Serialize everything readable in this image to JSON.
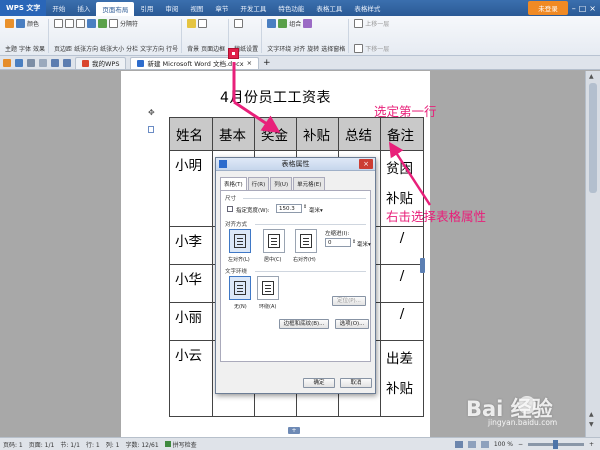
{
  "menubar": {
    "app_name": "WPS 文字",
    "tabs": [
      "开始",
      "插入",
      "页面布局",
      "引用",
      "审阅",
      "视图",
      "章节",
      "开发工具",
      "特色功能",
      "表格工具",
      "表格样式"
    ],
    "active_tab": "页面布局",
    "login_label": "未登录"
  },
  "ribbon": {
    "theme": "主题",
    "color": "颜色",
    "font": "字体",
    "effect": "效果",
    "margin": "页边距",
    "orientation": "纸张方向",
    "size": "纸张大小",
    "columns": "分栏",
    "text_direction": "文字方向",
    "line_numbers": "行号",
    "separator": "分隔符",
    "background": "背景",
    "page_border": "页面边框",
    "draft_setting": "稿纸设置",
    "text_wrap": "文字环绕",
    "align": "对齐",
    "rotate": "旋转",
    "group": "组合",
    "select_pane": "选择窗格",
    "bring_forward": "上移一层",
    "send_backward": "下移一层"
  },
  "tabs": {
    "tab1": "我的WPS",
    "tab2": "新建 Microsoft Word 文档.docx"
  },
  "document": {
    "title": "4月份员工工资表",
    "headers": [
      "姓名",
      "基本",
      "奖金",
      "补贴",
      "总结",
      "备注"
    ],
    "rows": [
      {
        "name": "小明",
        "remark": "贫困补贴"
      },
      {
        "name": "小李",
        "remark": "/"
      },
      {
        "name": "小华",
        "remark": "/"
      },
      {
        "name": "小丽",
        "remark": "/"
      },
      {
        "name": "小云",
        "remark": "出差补贴"
      }
    ]
  },
  "dialog": {
    "title": "表格属性",
    "close": "×",
    "tabs": [
      "表格(T)",
      "行(R)",
      "列(U)",
      "单元格(E)"
    ],
    "size_section": "尺寸",
    "width_label": "指定宽度(W):",
    "width_value": "150.3",
    "width_unit": "毫米▾",
    "align_section": "对齐方式",
    "align_left": "左对齐(L)",
    "align_center": "居中(C)",
    "align_right": "右对齐(H)",
    "indent_label": "左缩进(I):",
    "indent_value": "0",
    "indent_unit": "毫米▾",
    "wrap_section": "文字环绕",
    "wrap_none": "无(N)",
    "wrap_around": "环绕(A)",
    "position_btn": "定位(P)...",
    "borders_btn": "边框和底纹(B)...",
    "options_btn": "选项(O)...",
    "ok_btn": "确定",
    "cancel_btn": "取消"
  },
  "annotations": {
    "select_row": "选定第一行",
    "right_click": "右击选择表格属性"
  },
  "statusbar": {
    "page": "页码: 1",
    "pages": "页面: 1/1",
    "section": "节: 1/1",
    "row": "行: 1",
    "col": "列: 1",
    "words": "字数: 12/61",
    "spell": "拼写检查",
    "zoom": "100 %"
  },
  "watermark": {
    "text": "Bai  经验",
    "url": "jingyan.baidu.com"
  },
  "zoom_level": 0.5,
  "colors": {
    "accent": "#2b5a95",
    "annotation": "#e8207a",
    "header_fill": "#c9c9c9"
  }
}
